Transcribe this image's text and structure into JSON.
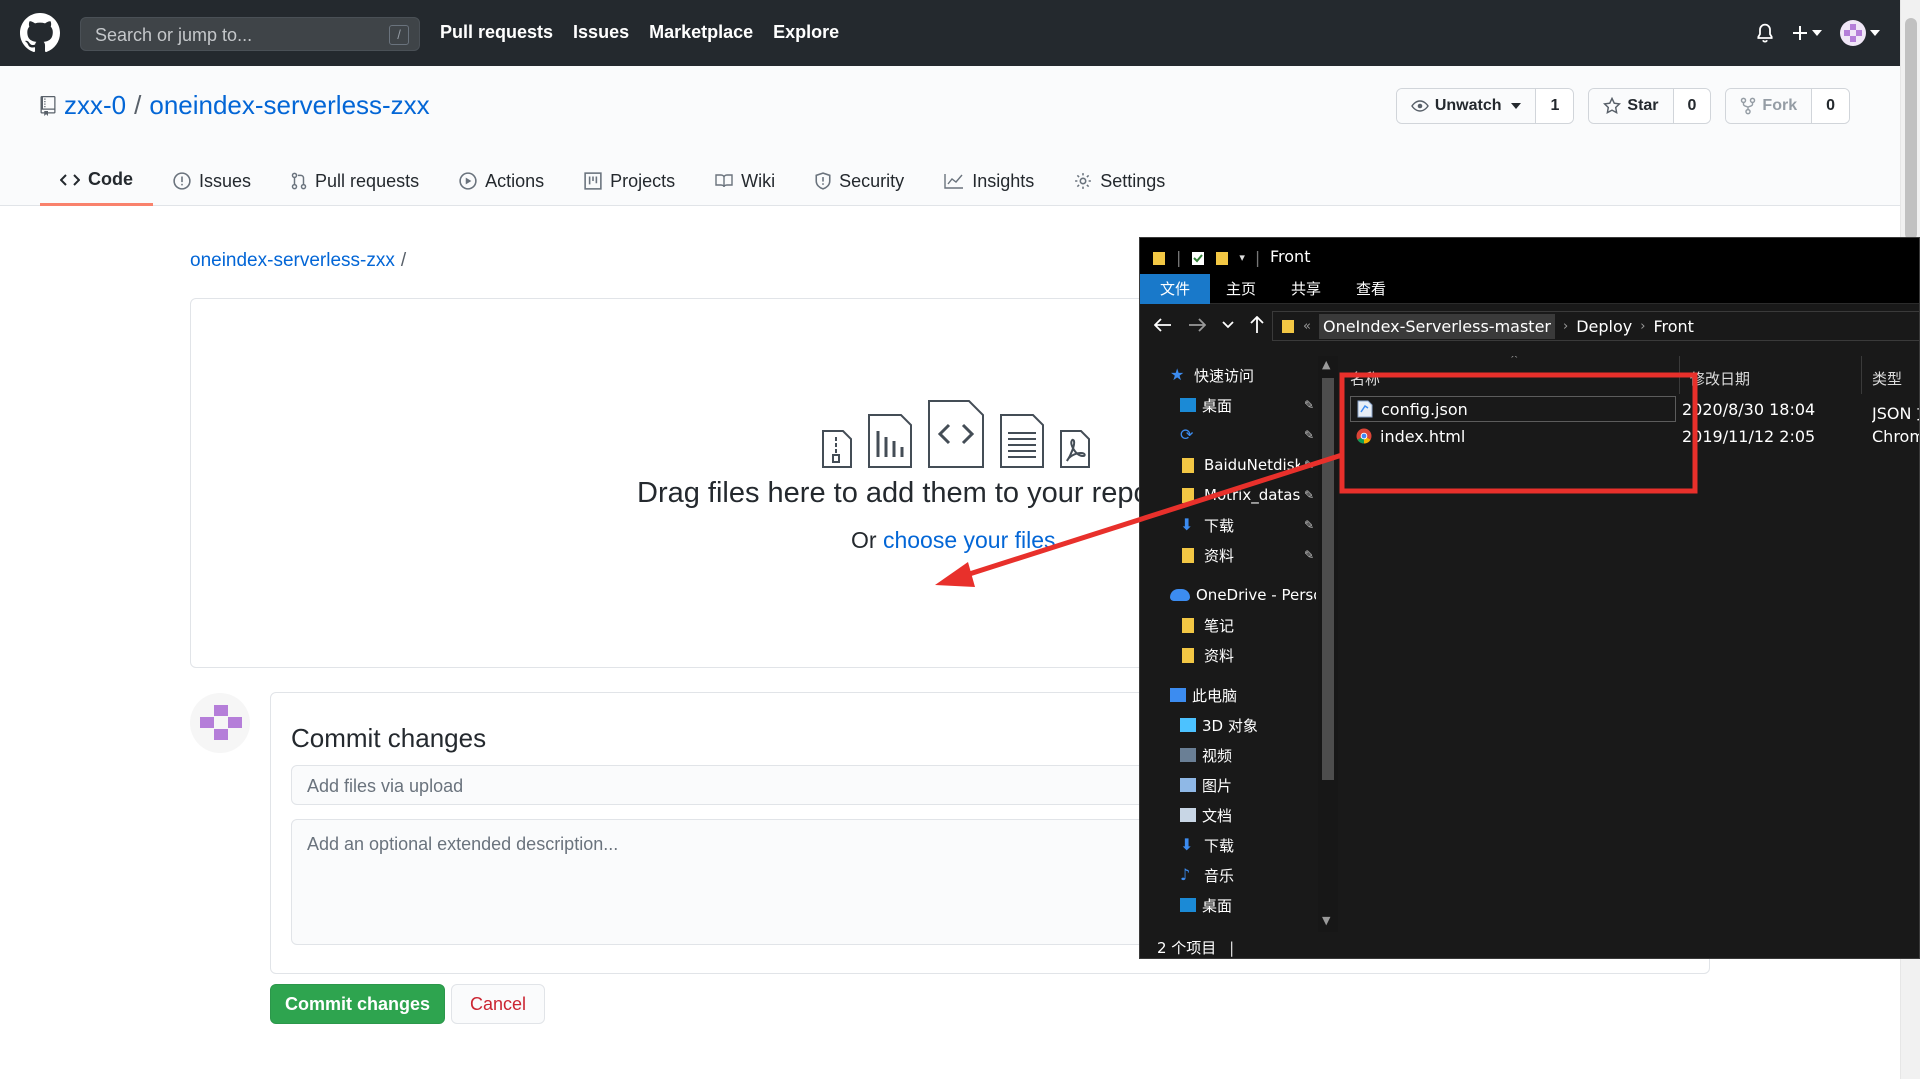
{
  "header": {
    "search_placeholder": "Search or jump to...",
    "search_shortcut": "/",
    "nav": [
      "Pull requests",
      "Issues",
      "Marketplace",
      "Explore"
    ]
  },
  "repo": {
    "owner": "zxx-0",
    "separator": "/",
    "name": "oneindex-serverless-zxx",
    "watch_label": "Unwatch",
    "watch_count": "1",
    "star_label": "Star",
    "star_count": "0",
    "fork_label": "Fork",
    "fork_count": "0",
    "tabs": [
      {
        "label": "Code",
        "icon": "code-icon",
        "active": true
      },
      {
        "label": "Issues",
        "icon": "issue-icon"
      },
      {
        "label": "Pull requests",
        "icon": "pull-request-icon"
      },
      {
        "label": "Actions",
        "icon": "play-icon"
      },
      {
        "label": "Projects",
        "icon": "project-icon"
      },
      {
        "label": "Wiki",
        "icon": "book-icon"
      },
      {
        "label": "Security",
        "icon": "shield-icon"
      },
      {
        "label": "Insights",
        "icon": "graph-icon"
      },
      {
        "label": "Settings",
        "icon": "gear-icon"
      }
    ]
  },
  "upload": {
    "breadcrumb_repo": "oneindex-serverless-zxx",
    "breadcrumb_sep": "/",
    "drop_title": "Drag files here to add them to your repository",
    "drop_or": "Or ",
    "drop_link": "choose your files"
  },
  "commit": {
    "title": "Commit changes",
    "summary_placeholder": "Add files via upload",
    "description_placeholder": "Add an optional extended description...",
    "commit_button": "Commit changes",
    "cancel_button": "Cancel"
  },
  "explorer": {
    "title": "Front",
    "ribbon_tabs": [
      "文件",
      "主页",
      "共享",
      "查看"
    ],
    "address": {
      "overflow": "«",
      "segments": [
        "OneIndex-Serverless-master",
        "Deploy",
        "Front"
      ]
    },
    "nav_items": [
      {
        "label": "快速访问",
        "icon": "star-icon",
        "color": "#3c8cf0",
        "indent": 0,
        "pinned": false
      },
      {
        "label": "桌面",
        "icon": "desktop-icon",
        "color": "#1b8ad6",
        "indent": 1,
        "pinned": true
      },
      {
        "label": "",
        "icon": "sync-icon",
        "color": "#3c8cf0",
        "indent": 1,
        "pinned": true
      },
      {
        "label": "BaiduNetdisk",
        "icon": "folder-icon",
        "color": "#f2c744",
        "indent": 1,
        "pinned": true
      },
      {
        "label": "Motrix_datas",
        "icon": "folder-icon",
        "color": "#f2c744",
        "indent": 1,
        "pinned": true
      },
      {
        "label": "下载",
        "icon": "download-icon",
        "color": "#3c8cf0",
        "indent": 1,
        "pinned": true
      },
      {
        "label": "资料",
        "icon": "folder-icon",
        "color": "#f2c744",
        "indent": 1,
        "pinned": true
      },
      {
        "label": "OneDrive - Perso",
        "icon": "cloud-icon",
        "color": "#3c8cf0",
        "indent": 0,
        "pinned": false,
        "gap": true
      },
      {
        "label": "笔记",
        "icon": "folder-icon",
        "color": "#f2c744",
        "indent": 1,
        "pinned": false
      },
      {
        "label": "资料",
        "icon": "folder-icon",
        "color": "#f2c744",
        "indent": 1,
        "pinned": false
      },
      {
        "label": "此电脑",
        "icon": "computer-icon",
        "color": "#3c8cf0",
        "indent": 0,
        "pinned": false,
        "gap": true
      },
      {
        "label": "3D 对象",
        "icon": "cube-icon",
        "color": "#4cc2ff",
        "indent": 1,
        "pinned": false
      },
      {
        "label": "视频",
        "icon": "film-icon",
        "color": "#6a7f95",
        "indent": 1,
        "pinned": false
      },
      {
        "label": "图片",
        "icon": "picture-icon",
        "color": "#8fb8e6",
        "indent": 1,
        "pinned": false
      },
      {
        "label": "文档",
        "icon": "document-icon",
        "color": "#c8d6e5",
        "indent": 1,
        "pinned": false
      },
      {
        "label": "下载",
        "icon": "download-icon",
        "color": "#3c8cf0",
        "indent": 1,
        "pinned": false
      },
      {
        "label": "音乐",
        "icon": "music-icon",
        "color": "#3c8cf0",
        "indent": 1,
        "pinned": false
      },
      {
        "label": "桌面",
        "icon": "desktop-icon",
        "color": "#1b8ad6",
        "indent": 1,
        "pinned": false
      }
    ],
    "columns": [
      "名称",
      "修改日期",
      "类型"
    ],
    "files": [
      {
        "name": "config.json",
        "date": "2020/8/30 18:04",
        "type": "JSON 文件",
        "icon": "json-file-icon",
        "selected": true
      },
      {
        "name": "index.html",
        "date": "2019/11/12 2:05",
        "type": "Chrome HTML",
        "icon": "chrome-icon",
        "selected": false
      }
    ],
    "status": "2 个项目"
  },
  "colors": {
    "header_bg": "#24292e",
    "link": "#0366d6",
    "active_tab": "#f9826c",
    "commit_green": "#2ea44f",
    "annotation_red": "#e8302b"
  }
}
